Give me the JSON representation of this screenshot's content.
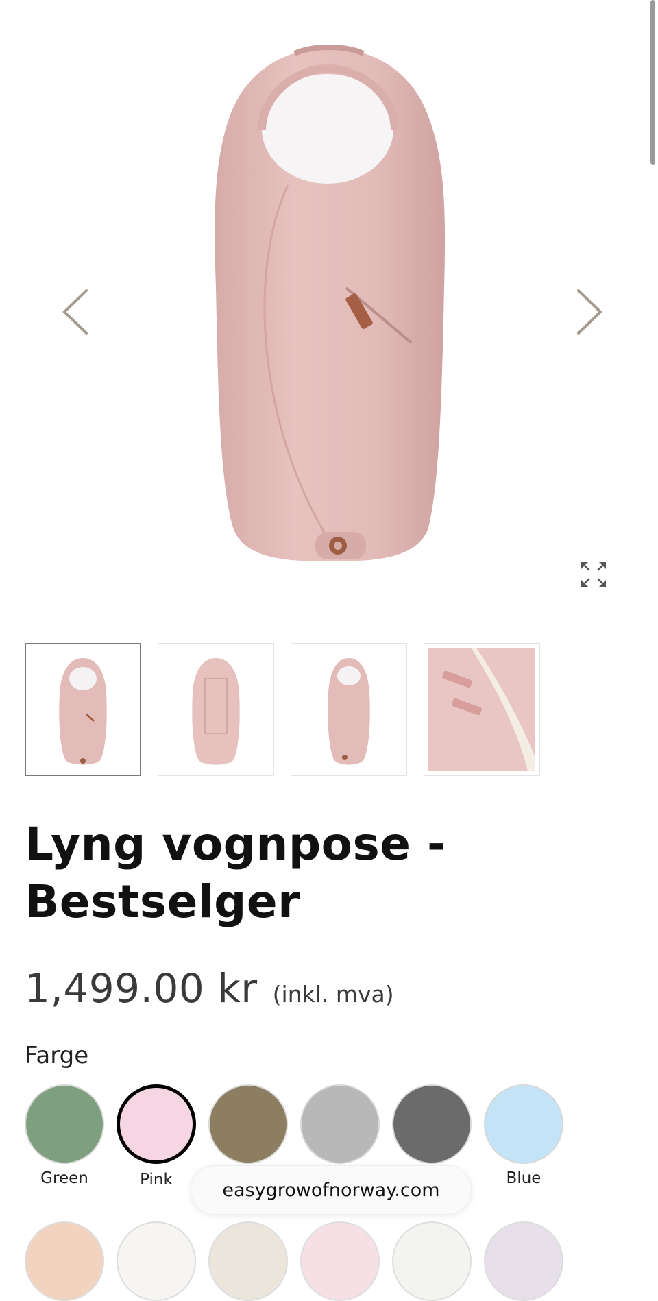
{
  "product": {
    "title": "Lyng vognpose - Bestselger",
    "price": "1,499.00 kr",
    "vat_note": "(inkl. mva)"
  },
  "gallery": {
    "thumbnail_count": 4,
    "active_index": 0
  },
  "color_option": {
    "label": "Farge",
    "swatches": [
      {
        "label": "Green",
        "color": "#7fa07e"
      },
      {
        "label": "Pink",
        "color": "#f6d6e2",
        "selected": true
      },
      {
        "label": "",
        "color": "#8d7d61"
      },
      {
        "label": "",
        "color": "#b8b8b8"
      },
      {
        "label": "",
        "color": "#6b6b6b"
      },
      {
        "label": "Blue",
        "color": "#c3e3f7"
      }
    ]
  },
  "browser": {
    "domain": "easygrowofnorway.com"
  },
  "colors": {
    "product_pink": "#e2b8b4",
    "arrow": "#a59a8e"
  }
}
